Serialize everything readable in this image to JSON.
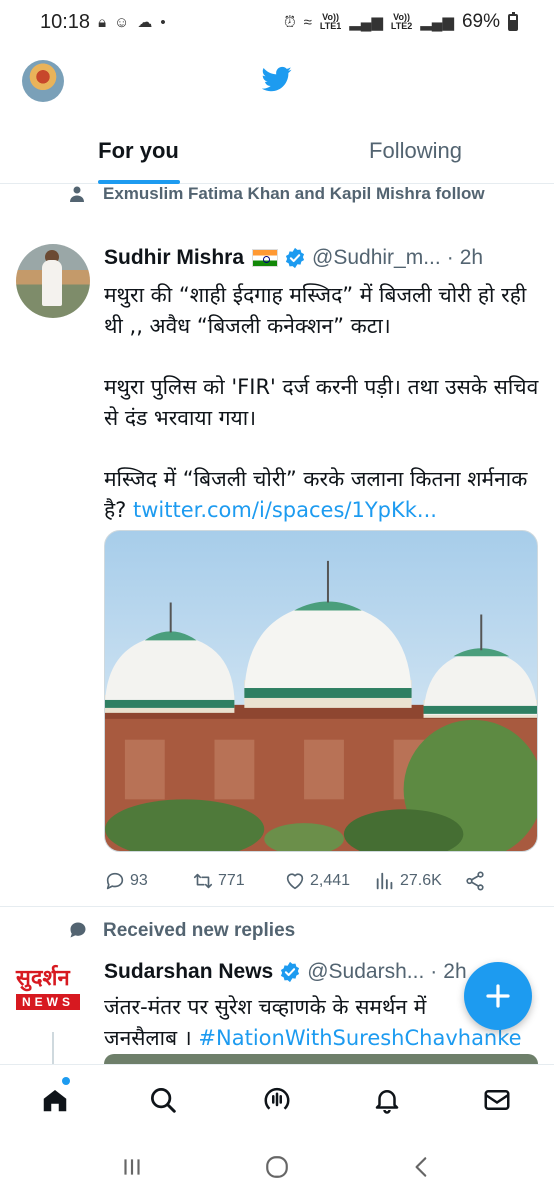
{
  "status_bar": {
    "time": "10:18",
    "lte1": "Vo))\nLTE1",
    "lte2": "Vo))\nLTE2",
    "battery": "69%"
  },
  "tabs": [
    {
      "label": "For you",
      "active": true
    },
    {
      "label": "Following",
      "active": false
    }
  ],
  "tweet1": {
    "social_context": "Exmuslim Fatima Khan and Kapil Mishra follow",
    "author_name": "Sudhir Mishra",
    "handle": "@Sudhir_m...",
    "dot": "·",
    "time": "2h",
    "paragraph1": "मथुरा की “शाही ईदगाह मस्जिद” में बिजली चोरी हो रही थी ,, अवैध “बिजली कनेक्शन” कटा।",
    "paragraph2": "मथुरा पुलिस को 'FIR' दर्ज करनी पड़ी। तथा उसके सचिव से दंड भरवाया गया।",
    "paragraph3": "मस्जिद में “बिजली चोरी” करके जलाना कितना शर्मनाक है?",
    "link": "twitter.com/i/spaces/1YpKk...",
    "replies": "93",
    "retweets": "771",
    "likes": "2,441",
    "views": "27.6K"
  },
  "tweet2": {
    "social_context": "Received new replies",
    "avatar_line1": "सुदर्शन",
    "avatar_line2": "NEWS",
    "author_name": "Sudarshan News",
    "handle": "@Sudarsh...",
    "dot": "·",
    "time": "2h",
    "text_line1": "जंतर-मंतर पर सुरेश चव्हाणके के समर्थन में",
    "text_line2_plain": "जनसैलाब । ",
    "hashtag": "#NationWithSureshChavhanke"
  },
  "colors": {
    "accent": "#1d9bf0",
    "text": "#0f1419",
    "secondary": "#536471"
  },
  "icons": {
    "home": "home-icon",
    "search": "search-icon",
    "spaces": "spaces-icon",
    "notifications": "bell-icon",
    "messages": "mail-icon"
  }
}
